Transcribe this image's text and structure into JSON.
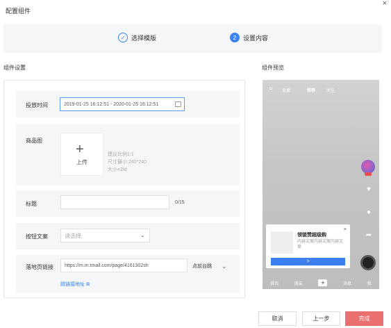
{
  "dialog": {
    "title": "配置组件",
    "close_icon": "×"
  },
  "steps": [
    {
      "label": "选择模版",
      "marker": "✓"
    },
    {
      "label": "设置内容",
      "marker": "2"
    }
  ],
  "sections": {
    "form": "组件设置",
    "preview": "组件预览"
  },
  "form": {
    "time_label": "投放时间",
    "time_value": "2019-01-25 16:12:51 - 2020-01-25 16:12:51",
    "image_label": "商品图",
    "upload_label": "上传",
    "upload_hints": [
      "建议比例1:1",
      "尺寸最小:240*240",
      "大小<2M"
    ],
    "title_label": "标题",
    "title_value": "",
    "title_counter": "0/15",
    "button_label": "按钮文案",
    "button_placeholder": "请选择",
    "url_label": "落地页链接",
    "url_value": "https://m.m.tmall.com/page/4161302sh",
    "open_mode": "点前台跳",
    "preview_link": "跳链接地址"
  },
  "preview": {
    "top_tabs": [
      "直播",
      "推荐",
      "关注"
    ],
    "card": {
      "title": "领锁赞超级购",
      "desc": "内容文案内容文案内容文案",
      "button": ">",
      "close": "×"
    },
    "side_labels": [
      "",
      "",
      ""
    ],
    "tabbar": [
      "首页",
      "朋友",
      "+",
      "消息",
      "我"
    ]
  },
  "footer": {
    "cancel": "取消",
    "prev": "上一步",
    "done": "完成"
  },
  "colors": {
    "accent": "#3b82f6",
    "done": "#ea6f6f"
  }
}
